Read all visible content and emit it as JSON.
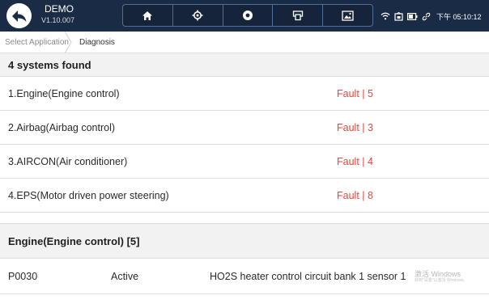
{
  "app": {
    "name": "DEMO",
    "version": "V1.10.007"
  },
  "toolbar": {
    "items": [
      {
        "icon": "home-icon"
      },
      {
        "icon": "settings-icon"
      },
      {
        "icon": "record-icon"
      },
      {
        "icon": "print-icon"
      },
      {
        "icon": "screenshot-icon"
      }
    ]
  },
  "status": {
    "time": "下午 05:10:12"
  },
  "breadcrumb": [
    "Select Application",
    "Diagnosis"
  ],
  "systems_found": "4 systems found",
  "systems": [
    {
      "name": "1.Engine(Engine control)",
      "status": "Fault | 5"
    },
    {
      "name": "2.Airbag(Airbag control)",
      "status": "Fault | 3"
    },
    {
      "name": "3.AIRCON(Air conditioner)",
      "status": "Fault | 4"
    },
    {
      "name": "4.EPS(Motor driven power steering)",
      "status": "Fault | 8"
    }
  ],
  "section_title": "Engine(Engine control) [5]",
  "dtcs": [
    {
      "code": "P0030",
      "state": "Active",
      "description": "HO2S heater control circuit bank 1  sensor 1"
    }
  ],
  "watermark": {
    "line1": "激活 Windows",
    "line2": "转到\"设置\"以激活 Windows。"
  },
  "colors": {
    "topbar": "#1a2b45",
    "fault": "#e8453c",
    "header_bg": "#f2f2f2"
  }
}
